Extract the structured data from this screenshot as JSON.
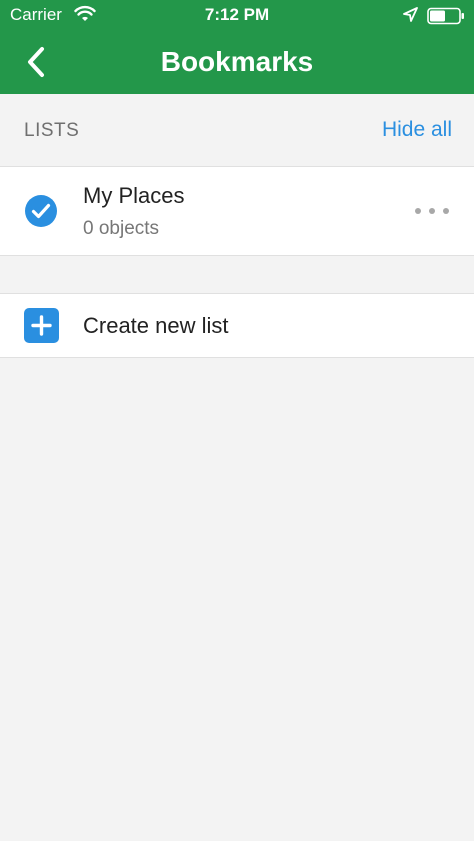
{
  "status_bar": {
    "carrier": "Carrier",
    "time": "7:12 PM",
    "wifi_icon": "wifi-icon",
    "location_icon": "location-arrow-icon",
    "battery_icon": "battery-icon"
  },
  "nav": {
    "title": "Bookmarks",
    "back_icon": "chevron-left-icon"
  },
  "lists_section": {
    "header": "LISTS",
    "action": "Hide all"
  },
  "lists": [
    {
      "title": "My Places",
      "subtitle": "0 objects",
      "checked": true,
      "check_icon": "checkmark-circle-icon",
      "more_icon": "more-horizontal-icon"
    }
  ],
  "create": {
    "label": "Create new list",
    "icon": "plus-square-icon"
  },
  "colors": {
    "brand_green": "#23974a",
    "accent_blue": "#2a8fe0",
    "background": "#f3f3f3"
  }
}
